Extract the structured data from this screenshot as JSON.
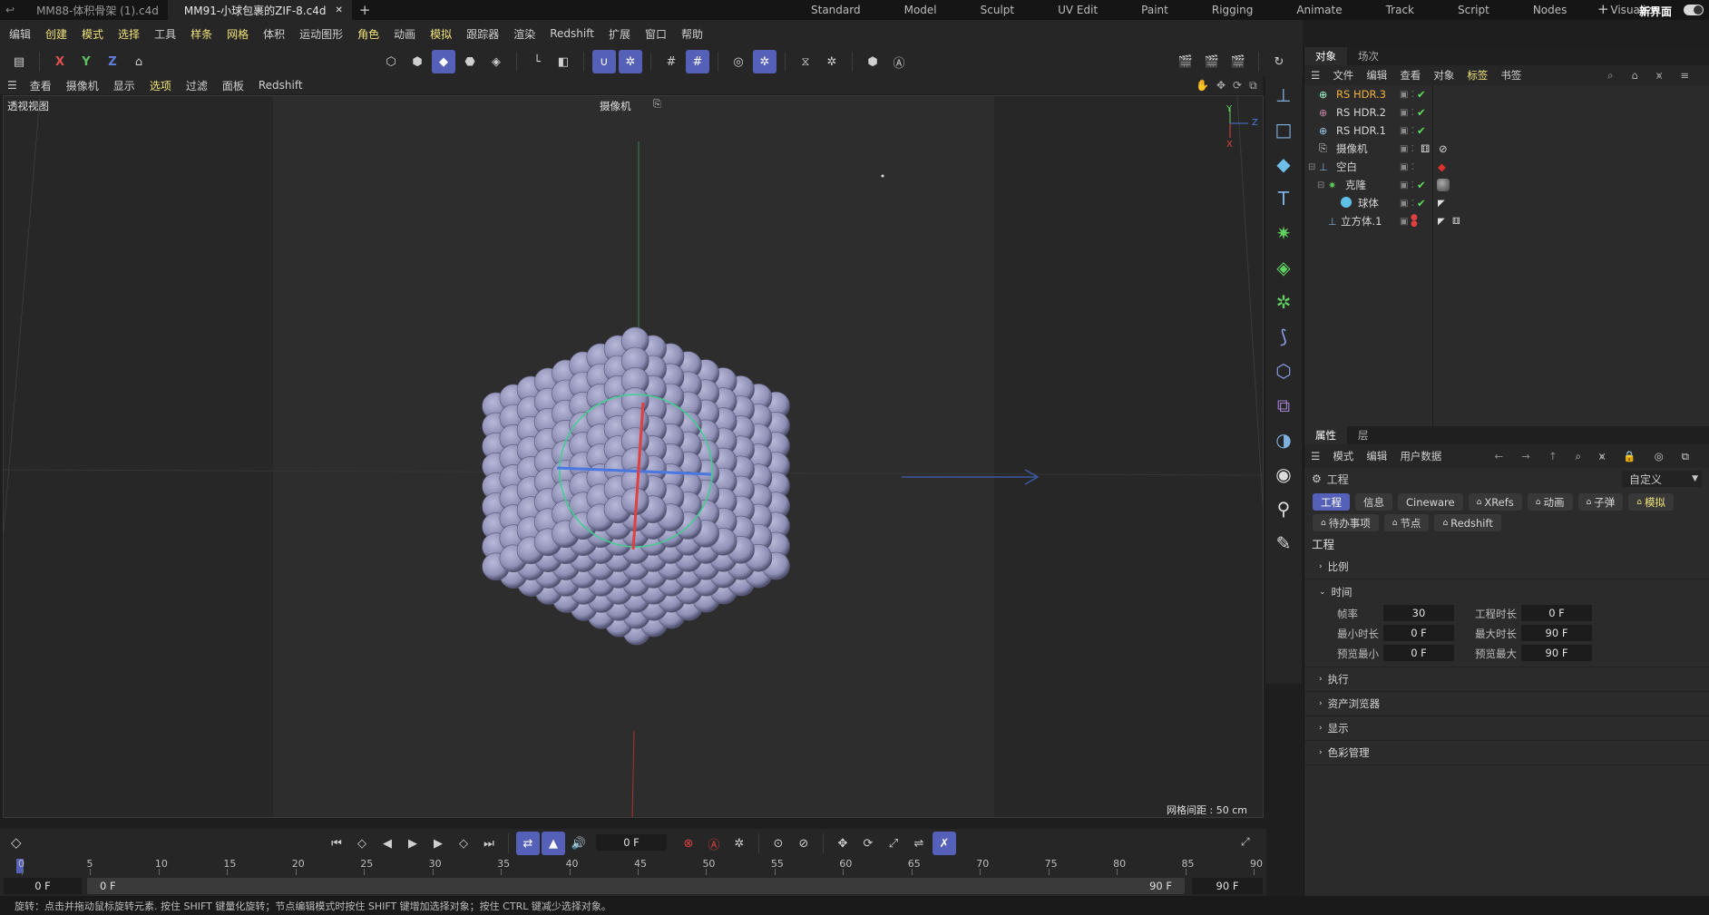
{
  "top": {
    "file_tabs": [
      {
        "label": "MM88-体积骨架 (1).c4d",
        "active": false
      },
      {
        "label": "MM91-小球包裹的ZIF-8.c4d",
        "active": true
      }
    ],
    "close_glyph": "✕",
    "add_glyph": "+",
    "layouts": [
      "Standard",
      "Model",
      "Sculpt",
      "UV Edit",
      "Paint",
      "Rigging",
      "Animate",
      "Track",
      "Script",
      "Nodes",
      "Visualize"
    ],
    "new_ui": "新界面"
  },
  "menu": {
    "items": [
      "编辑",
      "创建",
      "模式",
      "选择",
      "工具",
      "样条",
      "网格",
      "体积",
      "运动图形",
      "角色",
      "动画",
      "模拟",
      "跟踪器",
      "渲染",
      "Redshift",
      "扩展",
      "窗口",
      "帮助"
    ],
    "highlight": [
      "创建",
      "模式",
      "选择",
      "样条",
      "网格",
      "角色",
      "模拟"
    ]
  },
  "toolbar": {
    "x_label": "X",
    "y_label": "Y",
    "z_label": "Z"
  },
  "viewport_menu": {
    "items": [
      "查看",
      "摄像机",
      "显示",
      "选项",
      "过滤",
      "面板",
      "Redshift"
    ],
    "highlight": [
      "选项"
    ]
  },
  "viewport": {
    "view_name": "透视视图",
    "camera_label": "摄像机",
    "grid_spacing": "网格间距 : 50 cm",
    "axis_y": "Y",
    "axis_z": "Z",
    "axis_x": "X"
  },
  "object_panel": {
    "tabs": [
      "对象",
      "场次"
    ],
    "menu": [
      "文件",
      "编辑",
      "查看",
      "对象",
      "标签",
      "书签"
    ],
    "objects": [
      {
        "name": "RS HDR.3",
        "icon": "hdr-icon",
        "highlight": true,
        "depth": 0
      },
      {
        "name": "RS HDR.2",
        "icon": "hdr-icon",
        "highlight": false,
        "depth": 0
      },
      {
        "name": "RS HDR.1",
        "icon": "hdr-icon",
        "highlight": false,
        "depth": 0
      },
      {
        "name": "摄像机",
        "icon": "camera-icon",
        "highlight": false,
        "depth": 0
      },
      {
        "name": "空白",
        "icon": "null-icon",
        "highlight": false,
        "depth": 0
      },
      {
        "name": "克隆",
        "icon": "cloner-icon",
        "highlight": false,
        "depth": 1
      },
      {
        "name": "球体",
        "icon": "sphere-icon",
        "highlight": false,
        "depth": 2
      },
      {
        "name": "立方体.1",
        "icon": "cube-icon",
        "highlight": false,
        "depth": 1
      }
    ]
  },
  "attr_panel": {
    "tabs": [
      "属性",
      "层"
    ],
    "menu": [
      "模式",
      "编辑",
      "用户数据"
    ],
    "object_label": "工程",
    "preset": "自定义",
    "buttons_row1": [
      "工程",
      "信息",
      "Cineware",
      "XRefs",
      "动画",
      "子弹",
      "模拟"
    ],
    "buttons_row2": [
      "待办事项",
      "节点",
      "Redshift"
    ],
    "section_title": "工程",
    "sections": [
      "比例",
      "时间",
      "执行",
      "资产浏览器",
      "显示",
      "色彩管理"
    ],
    "fields": {
      "fps_label": "帧率",
      "fps": "30",
      "proj_len_label": "工程时长",
      "proj_len": "0 F",
      "min_label": "最小时长",
      "min": "0 F",
      "max_label": "最大时长",
      "max": "90 F",
      "prev_min_label": "预览最小",
      "prev_min": "0 F",
      "prev_max_label": "预览最大",
      "prev_max": "90 F"
    }
  },
  "timeline": {
    "current_frame": "0 F",
    "ruler": [
      "0",
      "5",
      "10",
      "15",
      "20",
      "25",
      "30",
      "35",
      "40",
      "45",
      "50",
      "55",
      "60",
      "65",
      "70",
      "75",
      "80",
      "85",
      "90"
    ],
    "range_start": "0 F",
    "range_left": "0 F",
    "range_right": "90 F",
    "range_end": "90 F"
  },
  "status": "旋转：点击并拖动鼠标旋转元素. 按住 SHIFT 键量化旋转；节点编辑模式时按住 SHIFT 键增加选择对象；按住 CTRL 键减少选择对象。",
  "colors": {
    "accent": "#5560b8",
    "highlight_text": "#f0e27a",
    "sphere": "#8f90b6"
  }
}
